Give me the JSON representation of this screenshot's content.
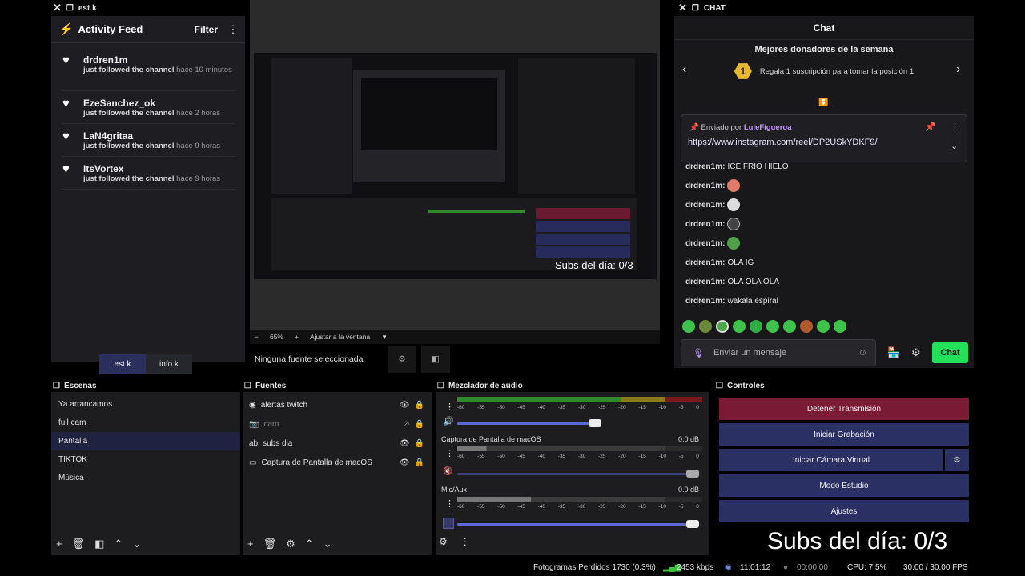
{
  "left_window": {
    "title": "est k"
  },
  "activity_feed": {
    "title": "Activity Feed",
    "filter": "Filter",
    "items": [
      {
        "name": "drdren1m",
        "action": "just followed the channel",
        "time": "hace 10 minutos"
      },
      {
        "name": "EzeSanchez_ok",
        "action": "just followed the channel",
        "time": "hace 2 horas"
      },
      {
        "name": "LaN4gritaa",
        "action": "just followed the channel",
        "time": "hace 9 horas"
      },
      {
        "name": "ItsVortex",
        "action": "just followed the channel",
        "time": "hace 9 horas"
      }
    ]
  },
  "dock_tabs": [
    "est k",
    "info k"
  ],
  "preview_toolbar": {
    "zoom": "65%",
    "fit": "Ajustar a la ventana",
    "minus": "−",
    "plus": "+"
  },
  "no_source": "Ninguna fuente seleccionada",
  "chat_window": {
    "title": "CHAT"
  },
  "chat": {
    "header": "Chat",
    "top_donors": "Mejores donadores de la semana",
    "rank": "1",
    "rank_text": "Regala 1 suscripción para tomar la posición 1",
    "pinned_by_label": "Enviado por",
    "pinned_user": "LuleFigueroa",
    "pinned_link": "https://www.instagram.com/reel/DP2USkYDKF9/",
    "messages": [
      {
        "user": "drdren1m:",
        "text": "ICE FRIO HIELO"
      },
      {
        "user": "drdren1m:",
        "text": ""
      },
      {
        "user": "drdren1m:",
        "text": ""
      },
      {
        "user": "drdren1m:",
        "text": ""
      },
      {
        "user": "drdren1m:",
        "text": ""
      },
      {
        "user": "drdren1m:",
        "text": "OLA IG"
      },
      {
        "user": "drdren1m:",
        "text": "OLA OLA OLA"
      },
      {
        "user": "drdren1m:",
        "text": "wakala espiral"
      }
    ],
    "input_placeholder": "Enviar un mensaje",
    "send_button": "Chat"
  },
  "scenes": {
    "title": "Escenas",
    "items": [
      "Ya arrancamos",
      "full cam",
      "Pantalla",
      "TIKTOK",
      "Música"
    ],
    "selected": "Pantalla"
  },
  "sources": {
    "title": "Fuentes",
    "items": [
      "alertas twitch",
      "cam",
      "subs dia",
      "Captura de Pantalla de macOS"
    ]
  },
  "mixer": {
    "title": "Mezclador de audio",
    "ticks": [
      "-60",
      "-55",
      "-50",
      "-45",
      "-40",
      "-35",
      "-30",
      "-25",
      "-20",
      "-15",
      "-10",
      "-5",
      "0"
    ],
    "channels": [
      {
        "name": "",
        "db": ""
      },
      {
        "name": "Captura de Pantalla de macOS",
        "db": "0.0 dB"
      },
      {
        "name": "Mic/Aux",
        "db": "0.0 dB"
      }
    ]
  },
  "controls": {
    "title": "Controles",
    "stop_stream": "Detener Transmisión",
    "start_record": "Iniciar Grabación",
    "virtual_cam": "Iniciar Cámara Virtual",
    "studio_mode": "Modo Estudio",
    "settings": "Ajustes"
  },
  "overlay": {
    "subs": "Subs del día: 0/3"
  },
  "status": {
    "dropped": "Fotogramas Perdidos 1730 (0.3%)",
    "bitrate": "2453 kbps",
    "stream_time": "11:01:12",
    "rec_time": "00:00:00",
    "cpu": "CPU: 7.5%",
    "fps": "30.00 / 30.00 FPS"
  },
  "colors": {
    "accent": "#2a3063",
    "stop": "#7a1a34",
    "chat_green": "#22e05a",
    "pin_purple": "#bf94ff"
  }
}
